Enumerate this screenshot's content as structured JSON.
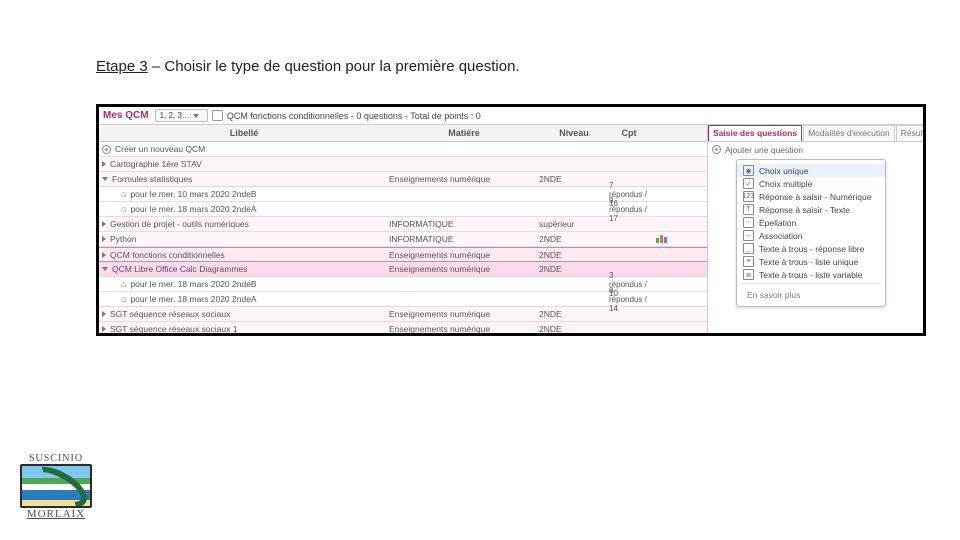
{
  "title_prefix": "Etape 3",
  "title_rest": " – Choisir le type de question pour la première question.",
  "topbar": {
    "label_mes_qcm": "Mes QCM",
    "num_btn": "1, 2, 3…",
    "crumb": "QCM fonctions conditionnelles - 0 questions - Total de points : 0"
  },
  "columns": {
    "libelle": "Libellé",
    "matiere": "Matière",
    "niveau": "Niveau",
    "cpt": "Cpt"
  },
  "rows": [
    {
      "kind": "create",
      "label": "Créer un nouveau QCM"
    },
    {
      "kind": "qcm-closed",
      "label": "Cartographie 1ère STAV"
    },
    {
      "kind": "qcm-open",
      "label": "Formules statistiques",
      "matiere": "Enseignements numérique",
      "niveau": "2NDE"
    },
    {
      "kind": "session",
      "label": "pour le mer. 10 mars 2020  2ndeB",
      "cpt": "7 répondus / 16"
    },
    {
      "kind": "session",
      "label": "pour le mer. 18 mars 2020  2ndeA",
      "cpt": "9 répondus / 17"
    },
    {
      "kind": "qcm-closed",
      "label": "Gestion de projet - outils numériques",
      "matiere": "INFORMATIQUE",
      "niveau": "supérieur"
    },
    {
      "kind": "qcm-closed",
      "label": "Python",
      "matiere": "INFORMATIQUE",
      "niveau": "2NDE",
      "chart": true
    },
    {
      "kind": "qcm-sel",
      "label": "QCM fonctions conditionnelles",
      "matiere": "Enseignements numérique",
      "niveau": "2NDE"
    },
    {
      "kind": "qcm-open",
      "label": "QCM Libre Office Calc Diagrammes",
      "matiere": "Enseignements numérique",
      "niveau": "2NDE"
    },
    {
      "kind": "session",
      "label": "pour le mer. 18 mars 2020  2ndeB",
      "cpt": "3 répondus / 10"
    },
    {
      "kind": "session",
      "label": "pour le mer. 18 mars 2020  2ndeA",
      "cpt": "8 répondus / 14"
    },
    {
      "kind": "qcm-closed",
      "label": "SGT séquence réseaux sociaux",
      "matiere": "Enseignements numérique",
      "niveau": "2NDE"
    },
    {
      "kind": "qcm-closed",
      "label": "SGT séquence réseaux sociaux 1",
      "matiere": "Enseignements numérique",
      "niveau": "2NDE"
    }
  ],
  "rpane": {
    "tabs": {
      "saisie": "Saisie des questions",
      "modalites": "Modalités d'exécution",
      "resultats": "Résultats"
    },
    "add_label": "Ajouter une question",
    "items": [
      "Choix unique",
      "Choix multiple",
      "Réponse à saisir - Numérique",
      "Réponse à saisir - Texte",
      "Épellation",
      "Association",
      "Texte à trous - réponse libre",
      "Texte à trous - liste unique",
      "Texte à trous - liste variable"
    ],
    "learn_more": "En savoir plus"
  },
  "logo": {
    "top": "SUSCINIO",
    "bottom": "MORLAIX"
  }
}
